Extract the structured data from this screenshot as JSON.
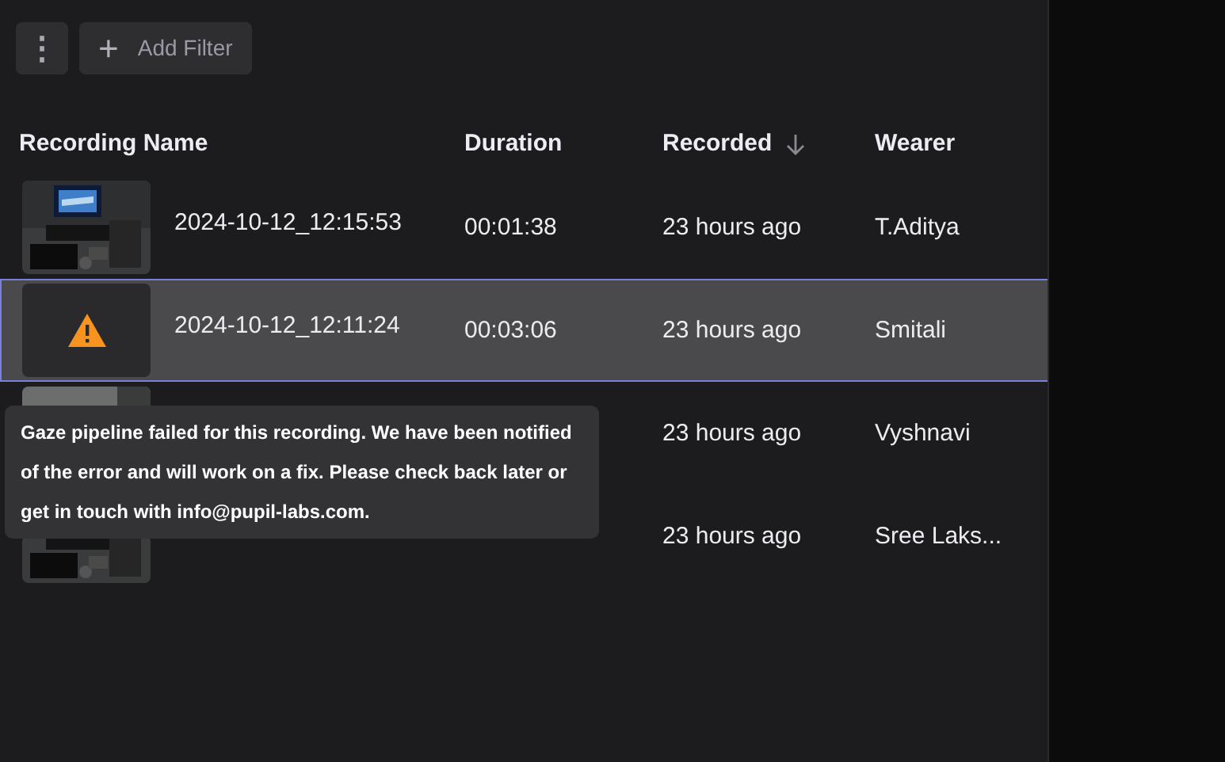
{
  "toolbar": {
    "more_button": "⋮",
    "add_filter": {
      "icon": "+",
      "label": "Add Filter"
    }
  },
  "table": {
    "columns": [
      {
        "label": "Recording Name"
      },
      {
        "label": "Duration"
      },
      {
        "label": "Recorded",
        "sorted_descending": true
      },
      {
        "label": "Wearer"
      }
    ],
    "rows": [
      {
        "kind": "picture",
        "selected": false,
        "name": "2024-10-12_12:15:53",
        "duration": "00:01:38",
        "recorded": "23 hours ago",
        "wearer": "T.Aditya"
      },
      {
        "kind": "warning",
        "selected": true,
        "name": "2024-10-12_12:11:24",
        "duration": "00:03:06",
        "recorded": "23 hours ago",
        "wearer": "Smitali"
      },
      {
        "kind": "picture",
        "selected": false,
        "recorded": "23 hours ago",
        "wearer": "Vyshnavi"
      },
      {
        "kind": "picture",
        "selected": false,
        "recorded": "23 hours ago",
        "wearer": "Sree Laks..."
      }
    ]
  },
  "tooltip": {
    "text": "Gaze pipeline failed for this recording. We have been notified of the error and will work on a fix. Please check back later or get in touch with info@pupil-labs.com."
  }
}
